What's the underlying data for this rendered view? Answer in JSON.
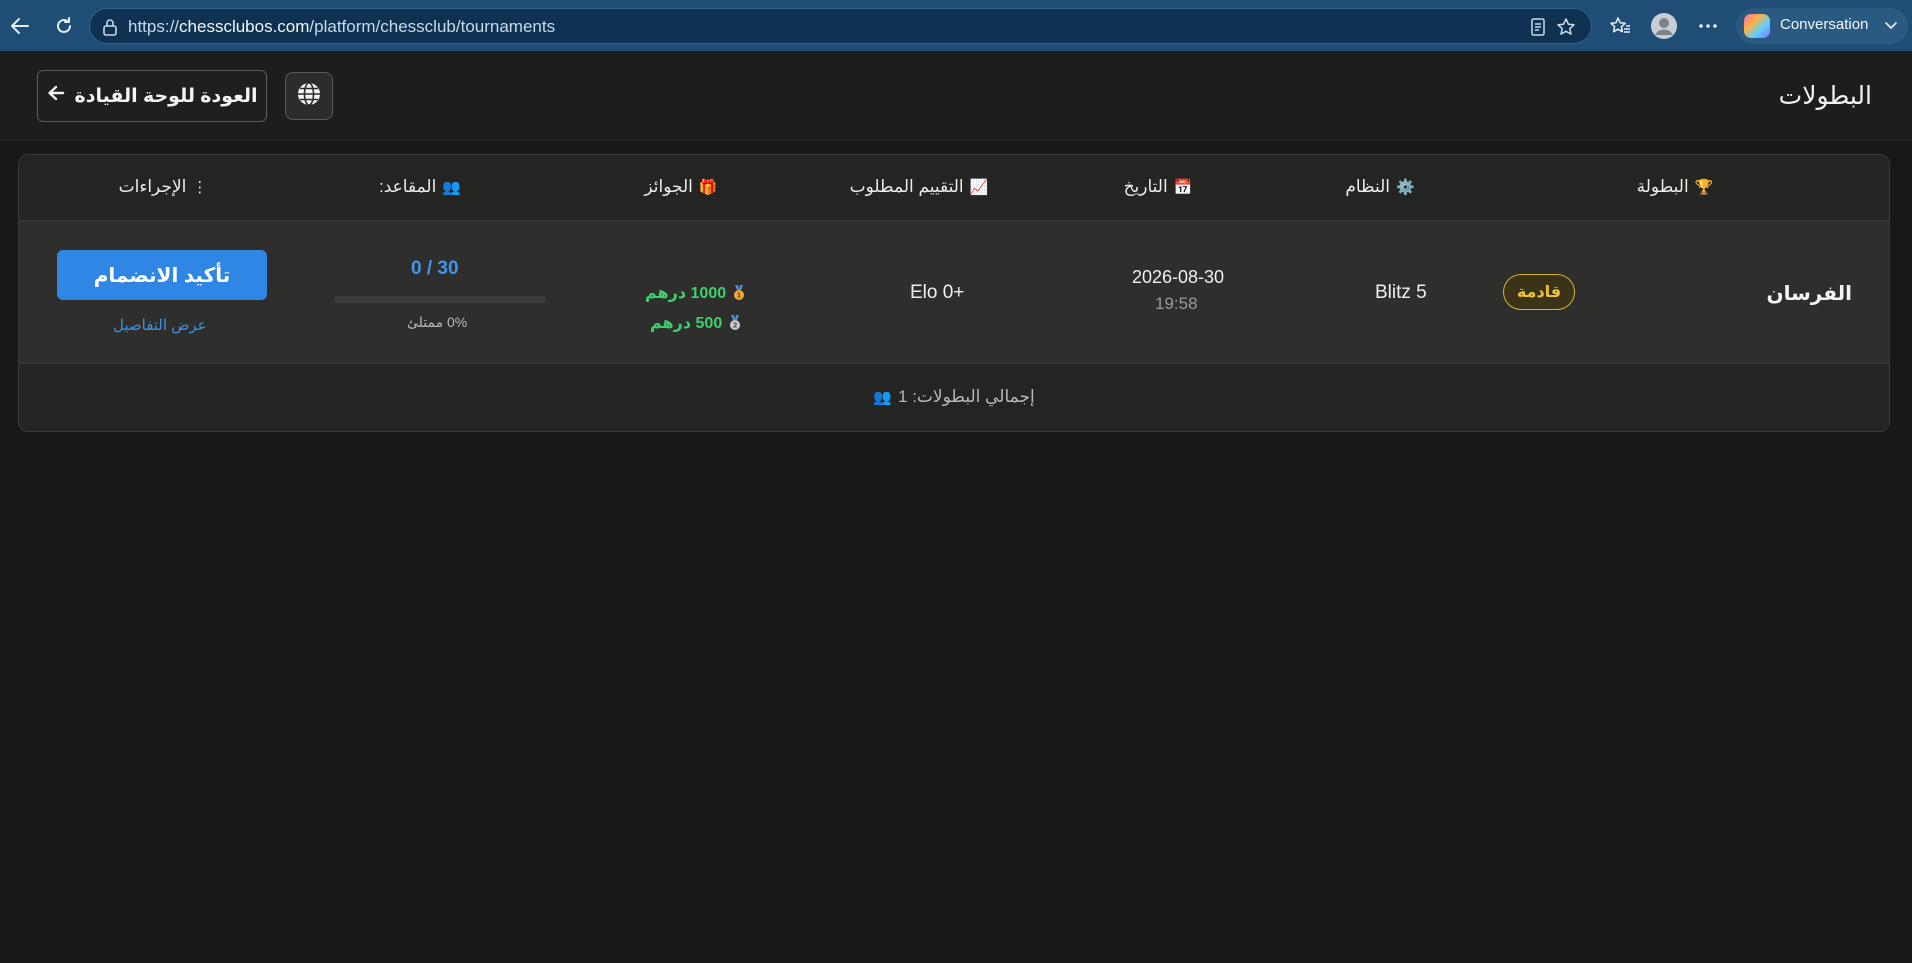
{
  "browser": {
    "url_prefix": "https://",
    "url_host": "chessclubos.com",
    "url_path": "/platform/chessclub/tournaments",
    "copilot_label": "Conversation"
  },
  "header": {
    "title": "البطولات",
    "back_label": "العودة للوحة القيادة"
  },
  "table": {
    "columns": [
      {
        "icon": "🏆",
        "label": "البطولة"
      },
      {
        "icon": "⚙️",
        "label": "النظام"
      },
      {
        "icon": "📅",
        "label": "التاريخ"
      },
      {
        "icon": "📈",
        "label": "التقييم المطلوب"
      },
      {
        "icon": "🎁",
        "label": "الجوائز"
      },
      {
        "icon": "👥",
        "label": "المقاعد:"
      },
      {
        "icon": "⋮",
        "label": "الإجراءات"
      }
    ],
    "rows": [
      {
        "name": "الفرسان",
        "status": "قادمة",
        "system": "Blitz 5",
        "date": "2026-08-30",
        "time": "19:58",
        "rating": "Elo 0+",
        "prizes": [
          "1000 درهم",
          "500 درهم"
        ],
        "seats": "0 / 30",
        "fill_fraction": 0,
        "fill_text": "0% ممتلئ",
        "join_label": "تأكيد الانضمام",
        "details_label": "عرض التفاصيل"
      }
    ],
    "footer_total": "إجمالي البطولات: 1"
  },
  "colors": {
    "accent_blue": "#2f86e4",
    "prize_green": "#3fcf6e",
    "status_gold": "#f0c237",
    "chrome_blue": "#1f4d75"
  },
  "icons": [
    "back-arrow-icon",
    "refresh-icon",
    "lock-icon",
    "reader-mode-icon",
    "favorite-star-icon",
    "favorites-icon",
    "profile-icon",
    "more-icon",
    "copilot-icon",
    "chevron-down-icon",
    "arrow-right-icon",
    "globe-icon",
    "trophy-icon",
    "gear-icon",
    "calendar-icon",
    "chart-icon",
    "gift-icon",
    "people-icon",
    "menu-dots-icon",
    "gold-medal-icon",
    "silver-medal-icon"
  ]
}
